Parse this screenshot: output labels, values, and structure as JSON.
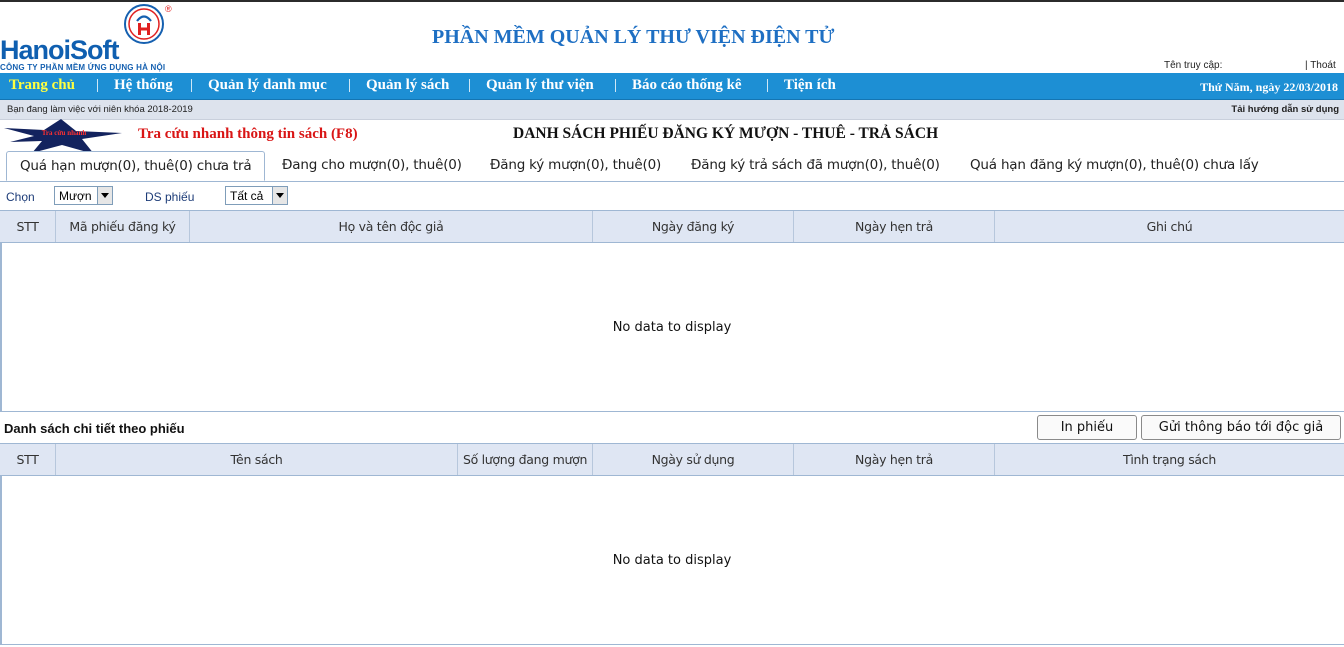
{
  "header": {
    "logo_text_main": "Hanoi",
    "logo_text_accent": "Soft",
    "company_subtitle": "CÔNG TY PHẦN MỀM ỨNG DỤNG HÀ NỘI",
    "registered_mark": "®",
    "app_title": "PHẦN MỀM QUẢN LÝ THƯ VIỆN ĐIỆN TỬ",
    "access_label": "Tên truy cập:",
    "logout": "| Thoát"
  },
  "menu": {
    "items": [
      {
        "label": "Trang chủ",
        "active": true
      },
      {
        "label": "Hệ thống"
      },
      {
        "label": "Quản lý danh mục"
      },
      {
        "label": "Quản lý sách"
      },
      {
        "label": "Quản lý thư viện"
      },
      {
        "label": "Báo cáo thống kê"
      },
      {
        "label": "Tiện ích"
      }
    ],
    "separator": "|",
    "date": "Thứ Năm, ngày 22/03/2018"
  },
  "infobar": {
    "school_year": "Bạn đang làm việc với niên khóa 2018-2019",
    "guide_link": "Tải hướng dẫn sử dụng"
  },
  "quick_search": {
    "badge_text": "Tra cứu nhanh",
    "link": "Tra cứu nhanh thông tin sách (F8)"
  },
  "page_title": "DANH SÁCH PHIẾU ĐĂNG KÝ MƯỢN - THUÊ - TRẢ SÁCH",
  "tabs": [
    {
      "label": "Quá hạn mượn(0), thuê(0) chưa trả",
      "active": true
    },
    {
      "label": "Đang cho mượn(0), thuê(0)"
    },
    {
      "label": "Đăng ký mượn(0), thuê(0)"
    },
    {
      "label": "Đăng ký trả sách đã mượn(0), thuê(0)"
    },
    {
      "label": "Quá hạn đăng ký mượn(0), thuê(0) chưa lấy"
    }
  ],
  "filters": {
    "choose_label": "Chọn",
    "choose_value": "Mượn",
    "ds_label": "DS phiếu",
    "ds_value": "Tất cả"
  },
  "grid1": {
    "columns": [
      "STT",
      "Mã phiếu đăng ký",
      "Họ và tên độc giả",
      "Ngày đăng ký",
      "Ngày hẹn trả",
      "Ghi chú"
    ],
    "empty_text": "No data to display"
  },
  "detail": {
    "title": "Danh sách chi tiết theo phiếu",
    "print_button": "In phiếu",
    "notify_button": "Gửi thông báo tới độc giả"
  },
  "grid2": {
    "columns": [
      "STT",
      "Tên sách",
      "Số lượng đang mượn",
      "Ngày sử dụng",
      "Ngày hẹn trả",
      "Tình trạng sách"
    ],
    "empty_text": "No data to display"
  },
  "colors": {
    "menubar": "#1d8fd4",
    "title_blue": "#1e6fc3",
    "quick_red": "#d91515",
    "grid_header": "#dfe6f3"
  }
}
